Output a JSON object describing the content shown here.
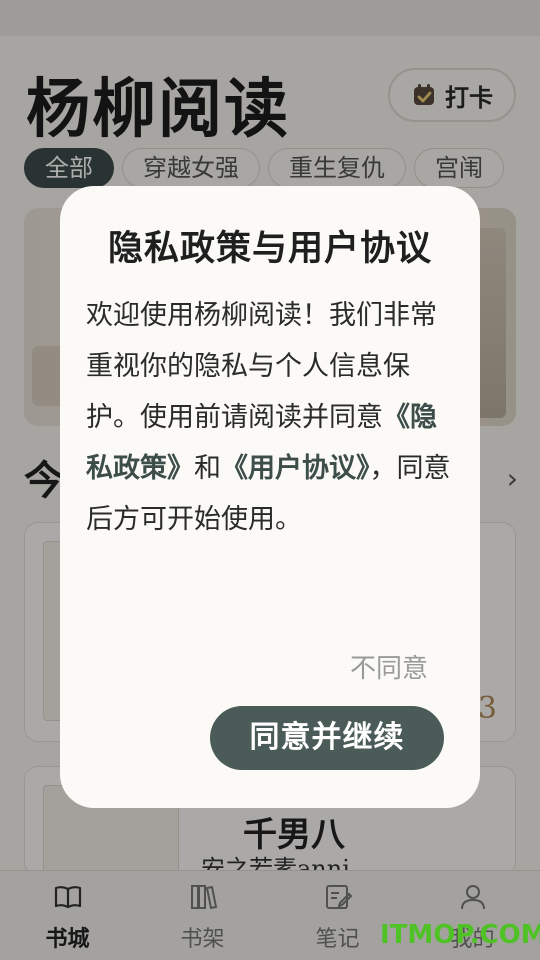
{
  "app": {
    "title": "杨柳阅读"
  },
  "header": {
    "checkin_label": "打卡"
  },
  "category_tabs": [
    "全部",
    "穿越女强",
    "重生复仇",
    "宫闱"
  ],
  "section": {
    "title_partial": "今"
  },
  "cards": {
    "card1_number": "3",
    "card2_title_partial": "千男八",
    "card2_author": "安之若素anni..."
  },
  "dialog": {
    "title": "隐私政策与用户协议",
    "body_part1": "欢迎使用杨柳阅读！我们非常重视你的隐私与个人信息保护。使用前请阅读并同意",
    "privacy_link": "《隐私政策》",
    "body_and": "和",
    "agreement_link": "《用户协议》",
    "body_part2": "，同意后方可开始使用。",
    "decline_label": "不同意",
    "accept_label": "同意并继续"
  },
  "tabbar": [
    {
      "label": "书城",
      "icon": "book-open-icon",
      "active": true
    },
    {
      "label": "书架",
      "icon": "bookshelf-icon",
      "active": false
    },
    {
      "label": "笔记",
      "icon": "note-edit-icon",
      "active": false
    },
    {
      "label": "我的",
      "icon": "person-icon",
      "active": false
    }
  ],
  "watermark": "ITMOP.COM",
  "colors": {
    "accent": "#3d4d4a",
    "watermark": "#4fc326",
    "number": "#b08a55"
  }
}
